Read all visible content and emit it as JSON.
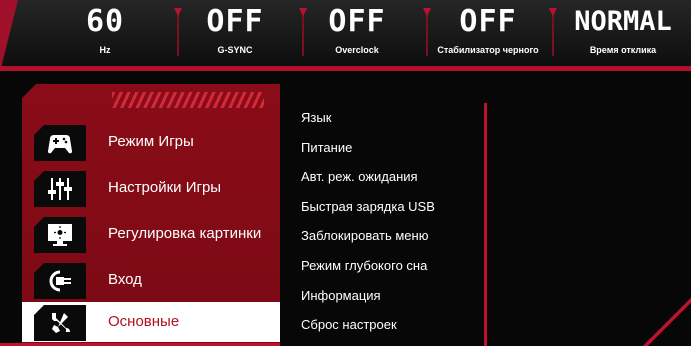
{
  "status_bar": {
    "items": [
      {
        "value": "60",
        "label": "Hz"
      },
      {
        "value": "OFF",
        "label": "G-SYNC"
      },
      {
        "value": "OFF",
        "label": "Overclock"
      },
      {
        "value": "OFF",
        "label": "Стабилизатор черного"
      },
      {
        "value": "NORMAL",
        "label": "Время отклика"
      }
    ]
  },
  "main_menu": {
    "items": [
      {
        "label": "Режим Игры",
        "icon": "gamepad-icon"
      },
      {
        "label": "Настройки Игры",
        "icon": "sliders-icon"
      },
      {
        "label": "Регулировка картинки",
        "icon": "monitor-brightness-icon"
      },
      {
        "label": "Вход",
        "icon": "input-plug-icon"
      },
      {
        "label": "Основные",
        "icon": "wrench-screwdriver-icon",
        "selected": true
      }
    ]
  },
  "submenu": {
    "items": [
      "Язык",
      "Питание",
      "Авт. реж. ожидания",
      "Быстрая зарядка USB",
      "Заблокировать меню",
      "Режим глубокого сна",
      "Информация",
      "Сброс настроек"
    ]
  },
  "colors": {
    "accent": "#c01030",
    "panel_red": "#8a0c18",
    "selected_text": "#b0101e",
    "background": "#070707"
  }
}
